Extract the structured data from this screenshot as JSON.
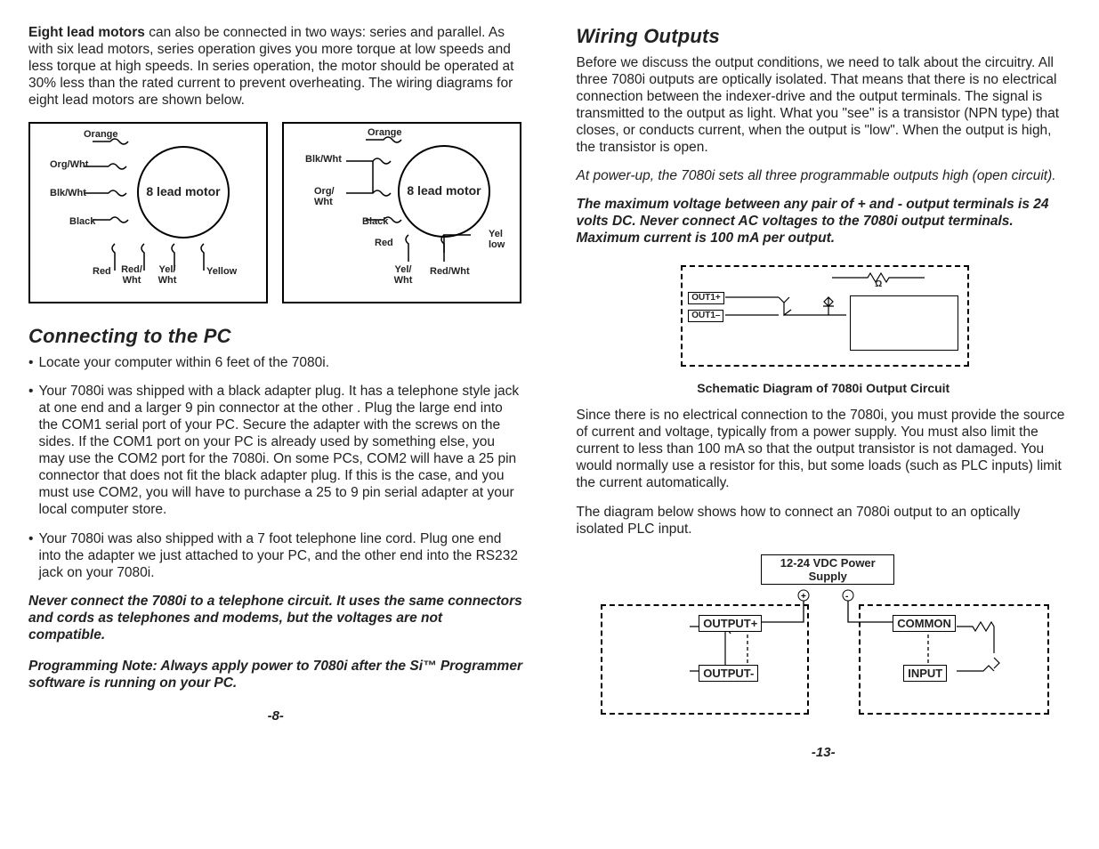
{
  "left": {
    "intro_lead": "Eight lead motors",
    "intro_body": " can also be connected in two ways:  series and parallel.  As with six lead motors, series operation gives you more torque at low speeds and less torque at high speeds.  In series operation, the motor should be operated at 30% less than the rated current to prevent overheating.  The wiring diagrams for eight lead motors are shown below.",
    "diag_label": "8 lead motor",
    "diag_a": {
      "top": "Orange",
      "l1": "Org/Wht",
      "l2": "Blk/Wht",
      "black": "Black",
      "b1": "Red",
      "b2": "Red/ Wht",
      "b3": "Yel/ Wht",
      "b4": "Yellow"
    },
    "diag_b": {
      "top": "Orange",
      "l1": "Blk/Wht",
      "l2": "Org/ Wht",
      "black": "Black",
      "red": "Red",
      "b1": "Yel/ Wht",
      "b2": "Red/Wht",
      "r1": "Yel low"
    },
    "heading_pc": "Connecting to the PC",
    "bullets": [
      "Locate your computer within 6 feet of the 7080i.",
      "Your 7080i was shipped with a black adapter  plug.  It has a telephone style jack at one end and a larger 9 pin connector at the other .  Plug the large end into the COM1 serial port of your PC.  Secure the adapter with the screws on the sides.  If the COM1 port on your PC is already used by something else, you may use the COM2 port for the 7080i.  On some PCs, COM2 will have a 25 pin connector that does not fit the black adapter plug.  If this is the case, and you must use COM2, you will have to purchase a 25 to 9 pin serial adapter at your local computer store.",
      "Your  7080i was also shipped with a 7 foot telephone line cord.  Plug one end into the adapter we just attached to your PC, and the other end into the RS232 jack on your 7080i."
    ],
    "warn1": "Never connect the 7080i to a telephone circuit.  It uses the same connectors and cords as telephones and modems, but the voltages are not compatible.",
    "warn2": "Programming Note: Always apply power to 7080i after the Si™ Programmer software is running on your PC.",
    "pagenum": "-8-"
  },
  "right": {
    "heading": "Wiring Outputs",
    "p1": "Before we discuss the output conditions, we need to talk about the circuitry.  All three 7080i outputs are optically isolated.  That means that there is no electrical connection between the indexer-drive and the output terminals.  The signal is transmitted to the output as light.  What you \"see\" is a transistor (NPN type) that closes, or conducts current, when the output is \"low\".  When the output is high, the transistor is open.",
    "note": "At power-up, the 7080i sets all three programmable outputs high (open circuit).",
    "warn": "The maximum voltage between any pair of + and - output terminals is 24 volts DC. Never connect AC voltages to the 7080i output terminals. Maximum current is 100 mA per output.",
    "schem": {
      "out1p": "OUT1+",
      "out1m": "OUT1–",
      "ohm": "Ω",
      "caption": "Schematic Diagram of 7080i Output Circuit"
    },
    "p2": "Since there is no electrical connection to the 7080i, you must provide the source of current and voltage, typically from a power supply.  You must also limit the current to less than 100 mA so that the output transistor is not damaged.  You would normally use a resistor for this, but some loads (such as PLC inputs) limit the current automatically.",
    "p3": "The diagram below shows how to connect an 7080i output to an optically isolated PLC input.",
    "plc": {
      "ps": "12-24 VDC Power Supply",
      "outp": "OUTPUT+",
      "outm": "OUTPUT-",
      "common": "COMMON",
      "input": "INPUT"
    },
    "pagenum": "-13-"
  }
}
